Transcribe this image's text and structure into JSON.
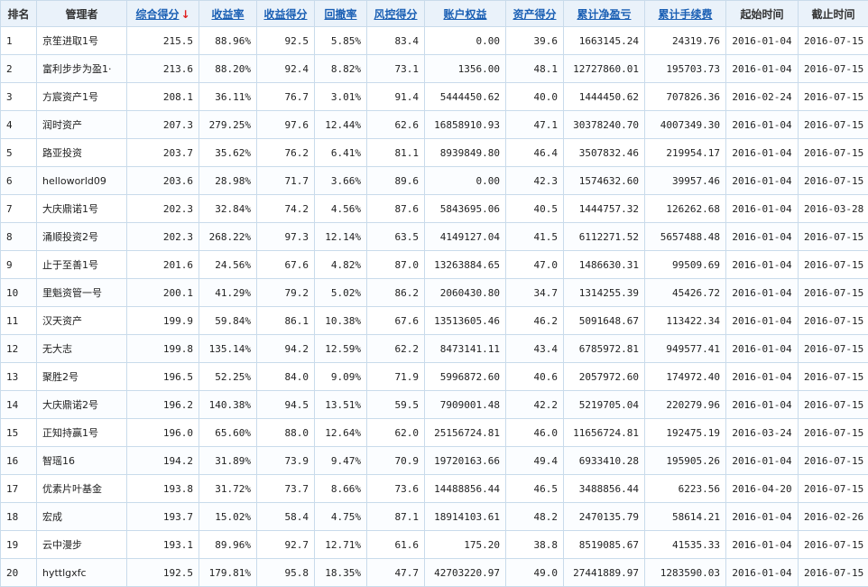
{
  "headers": {
    "rank": "排名",
    "manager": "管理者",
    "composite": "综合得分",
    "return_rate": "收益率",
    "return_score": "收益得分",
    "drawdown": "回撤率",
    "risk_score": "风控得分",
    "equity": "账户权益",
    "asset_score": "资产得分",
    "cum_pnl": "累计净盈亏",
    "cum_fee": "累计手续费",
    "start_date": "起始时间",
    "end_date": "截止时间",
    "sort_arrow": "↓"
  },
  "rows": [
    {
      "rank": "1",
      "manager": "京笙进取1号",
      "composite": "215.5",
      "return_rate": "88.96%",
      "return_score": "92.5",
      "drawdown": "5.85%",
      "risk_score": "83.4",
      "equity": "0.00",
      "asset_score": "39.6",
      "cum_pnl": "1663145.24",
      "cum_fee": "24319.76",
      "start": "2016-01-04",
      "end": "2016-07-15"
    },
    {
      "rank": "2",
      "manager": "富利步步为盈1·",
      "composite": "213.6",
      "return_rate": "88.20%",
      "return_score": "92.4",
      "drawdown": "8.82%",
      "risk_score": "73.1",
      "equity": "1356.00",
      "asset_score": "48.1",
      "cum_pnl": "12727860.01",
      "cum_fee": "195703.73",
      "start": "2016-01-04",
      "end": "2016-07-15"
    },
    {
      "rank": "3",
      "manager": "方宸资产1号",
      "composite": "208.1",
      "return_rate": "36.11%",
      "return_score": "76.7",
      "drawdown": "3.01%",
      "risk_score": "91.4",
      "equity": "5444450.62",
      "asset_score": "40.0",
      "cum_pnl": "1444450.62",
      "cum_fee": "707826.36",
      "start": "2016-02-24",
      "end": "2016-07-15"
    },
    {
      "rank": "4",
      "manager": "润时资产",
      "composite": "207.3",
      "return_rate": "279.25%",
      "return_score": "97.6",
      "drawdown": "12.44%",
      "risk_score": "62.6",
      "equity": "16858910.93",
      "asset_score": "47.1",
      "cum_pnl": "30378240.70",
      "cum_fee": "4007349.30",
      "start": "2016-01-04",
      "end": "2016-07-15"
    },
    {
      "rank": "5",
      "manager": "路亚投资",
      "composite": "203.7",
      "return_rate": "35.62%",
      "return_score": "76.2",
      "drawdown": "6.41%",
      "risk_score": "81.1",
      "equity": "8939849.80",
      "asset_score": "46.4",
      "cum_pnl": "3507832.46",
      "cum_fee": "219954.17",
      "start": "2016-01-04",
      "end": "2016-07-15"
    },
    {
      "rank": "6",
      "manager": "helloworld09",
      "composite": "203.6",
      "return_rate": "28.98%",
      "return_score": "71.7",
      "drawdown": "3.66%",
      "risk_score": "89.6",
      "equity": "0.00",
      "asset_score": "42.3",
      "cum_pnl": "1574632.60",
      "cum_fee": "39957.46",
      "start": "2016-01-04",
      "end": "2016-07-15"
    },
    {
      "rank": "7",
      "manager": "大庆鼎诺1号",
      "composite": "202.3",
      "return_rate": "32.84%",
      "return_score": "74.2",
      "drawdown": "4.56%",
      "risk_score": "87.6",
      "equity": "5843695.06",
      "asset_score": "40.5",
      "cum_pnl": "1444757.32",
      "cum_fee": "126262.68",
      "start": "2016-01-04",
      "end": "2016-03-28"
    },
    {
      "rank": "8",
      "manager": "涌顺投资2号",
      "composite": "202.3",
      "return_rate": "268.22%",
      "return_score": "97.3",
      "drawdown": "12.14%",
      "risk_score": "63.5",
      "equity": "4149127.04",
      "asset_score": "41.5",
      "cum_pnl": "6112271.52",
      "cum_fee": "5657488.48",
      "start": "2016-01-04",
      "end": "2016-07-15"
    },
    {
      "rank": "9",
      "manager": "止于至善1号",
      "composite": "201.6",
      "return_rate": "24.56%",
      "return_score": "67.6",
      "drawdown": "4.82%",
      "risk_score": "87.0",
      "equity": "13263884.65",
      "asset_score": "47.0",
      "cum_pnl": "1486630.31",
      "cum_fee": "99509.69",
      "start": "2016-01-04",
      "end": "2016-07-15"
    },
    {
      "rank": "10",
      "manager": "里魁资管一号",
      "composite": "200.1",
      "return_rate": "41.29%",
      "return_score": "79.2",
      "drawdown": "5.02%",
      "risk_score": "86.2",
      "equity": "2060430.80",
      "asset_score": "34.7",
      "cum_pnl": "1314255.39",
      "cum_fee": "45426.72",
      "start": "2016-01-04",
      "end": "2016-07-15"
    },
    {
      "rank": "11",
      "manager": "汉天资产",
      "composite": "199.9",
      "return_rate": "59.84%",
      "return_score": "86.1",
      "drawdown": "10.38%",
      "risk_score": "67.6",
      "equity": "13513605.46",
      "asset_score": "46.2",
      "cum_pnl": "5091648.67",
      "cum_fee": "113422.34",
      "start": "2016-01-04",
      "end": "2016-07-15"
    },
    {
      "rank": "12",
      "manager": "无大志",
      "composite": "199.8",
      "return_rate": "135.14%",
      "return_score": "94.2",
      "drawdown": "12.59%",
      "risk_score": "62.2",
      "equity": "8473141.11",
      "asset_score": "43.4",
      "cum_pnl": "6785972.81",
      "cum_fee": "949577.41",
      "start": "2016-01-04",
      "end": "2016-07-15"
    },
    {
      "rank": "13",
      "manager": "聚胜2号",
      "composite": "196.5",
      "return_rate": "52.25%",
      "return_score": "84.0",
      "drawdown": "9.09%",
      "risk_score": "71.9",
      "equity": "5996872.60",
      "asset_score": "40.6",
      "cum_pnl": "2057972.60",
      "cum_fee": "174972.40",
      "start": "2016-01-04",
      "end": "2016-07-15"
    },
    {
      "rank": "14",
      "manager": "大庆鼎诺2号",
      "composite": "196.2",
      "return_rate": "140.38%",
      "return_score": "94.5",
      "drawdown": "13.51%",
      "risk_score": "59.5",
      "equity": "7909001.48",
      "asset_score": "42.2",
      "cum_pnl": "5219705.04",
      "cum_fee": "220279.96",
      "start": "2016-01-04",
      "end": "2016-07-15"
    },
    {
      "rank": "15",
      "manager": "正知持赢1号",
      "composite": "196.0",
      "return_rate": "65.60%",
      "return_score": "88.0",
      "drawdown": "12.64%",
      "risk_score": "62.0",
      "equity": "25156724.81",
      "asset_score": "46.0",
      "cum_pnl": "11656724.81",
      "cum_fee": "192475.19",
      "start": "2016-03-24",
      "end": "2016-07-15"
    },
    {
      "rank": "16",
      "manager": "智瑶16",
      "composite": "194.2",
      "return_rate": "31.89%",
      "return_score": "73.9",
      "drawdown": "9.47%",
      "risk_score": "70.9",
      "equity": "19720163.66",
      "asset_score": "49.4",
      "cum_pnl": "6933410.28",
      "cum_fee": "195905.26",
      "start": "2016-01-04",
      "end": "2016-07-15"
    },
    {
      "rank": "17",
      "manager": "优素片叶基金",
      "composite": "193.8",
      "return_rate": "31.72%",
      "return_score": "73.7",
      "drawdown": "8.66%",
      "risk_score": "73.6",
      "equity": "14488856.44",
      "asset_score": "46.5",
      "cum_pnl": "3488856.44",
      "cum_fee": "6223.56",
      "start": "2016-04-20",
      "end": "2016-07-15"
    },
    {
      "rank": "18",
      "manager": "宏成",
      "composite": "193.7",
      "return_rate": "15.02%",
      "return_score": "58.4",
      "drawdown": "4.75%",
      "risk_score": "87.1",
      "equity": "18914103.61",
      "asset_score": "48.2",
      "cum_pnl": "2470135.79",
      "cum_fee": "58614.21",
      "start": "2016-01-04",
      "end": "2016-02-26"
    },
    {
      "rank": "19",
      "manager": "云中漫步",
      "composite": "193.1",
      "return_rate": "89.96%",
      "return_score": "92.7",
      "drawdown": "12.71%",
      "risk_score": "61.6",
      "equity": "175.20",
      "asset_score": "38.8",
      "cum_pnl": "8519085.67",
      "cum_fee": "41535.33",
      "start": "2016-01-04",
      "end": "2016-07-15"
    },
    {
      "rank": "20",
      "manager": "hyttlgxfc",
      "composite": "192.5",
      "return_rate": "179.81%",
      "return_score": "95.8",
      "drawdown": "18.35%",
      "risk_score": "47.7",
      "equity": "42703220.97",
      "asset_score": "49.0",
      "cum_pnl": "27441889.97",
      "cum_fee": "1283590.03",
      "start": "2016-01-04",
      "end": "2016-07-15"
    }
  ],
  "colors": {
    "header_bg": "#eaf2fa",
    "border": "#c9dbeb",
    "link": "#1a5fb4",
    "pnl": "#e02020"
  }
}
